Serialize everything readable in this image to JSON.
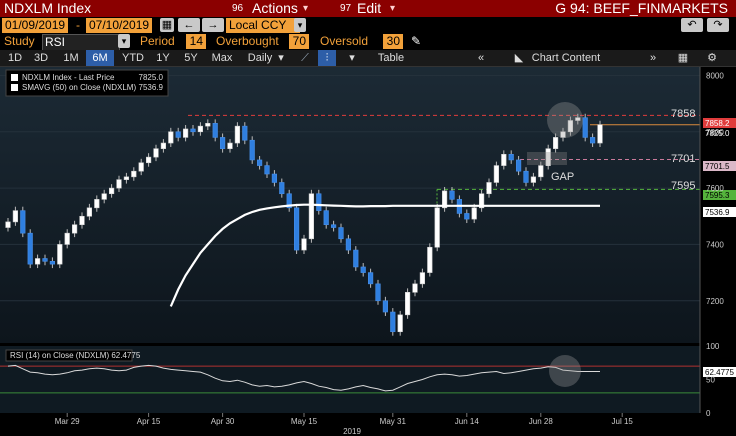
{
  "titlebar": {
    "ticker": "NDXLM Index",
    "actions_num": "96",
    "actions_label": "Actions",
    "edit_num": "97",
    "edit_label": "Edit",
    "page_label": "G 94: BEEF_FINMARKETS"
  },
  "controls": {
    "start_date": "01/09/2019",
    "end_date": "07/10/2019",
    "currency": "Local CCY",
    "study_label": "Study",
    "study_value": "RSI",
    "period_label": "Period",
    "period_value": "14",
    "overbought_label": "Overbought",
    "overbought_value": "70",
    "oversold_label": "Oversold",
    "oversold_value": "30"
  },
  "toolbar": {
    "ranges": [
      "1D",
      "3D",
      "1M",
      "6M",
      "YTD",
      "1Y",
      "5Y",
      "Max"
    ],
    "selected_range": "6M",
    "frequency": "Daily",
    "table_label": "Table",
    "chart_content_label": "Chart Content"
  },
  "legend": [
    {
      "name": "NDXLM Index - Last Price",
      "value": "7825.0"
    },
    {
      "name": "SMAVG (50)  on Close (NDXLM)",
      "value": "7536.9"
    }
  ],
  "annotations": {
    "level_high": "7858",
    "level_mid": "7701",
    "level_low": "7595",
    "gap_label": "GAP"
  },
  "badges": {
    "high": "7858.2",
    "last": "7825.0",
    "mid": "7701.5",
    "low": "7595.3",
    "sma": "7536.9",
    "rsi": "62.4775"
  },
  "rsi_legend": "RSI (14)  on Close (NDXLM)  62.4775",
  "year_label": "2019",
  "colors": {
    "up": "#ffffff",
    "down": "#2f7fe0",
    "sma": "#ffffff",
    "high_line": "#e03c3c",
    "low_line": "#55b43c"
  },
  "chart_data": {
    "type": "candlestick",
    "price_axis": {
      "min": 7050,
      "max": 8030,
      "ticks": [
        8000,
        7800,
        7600,
        7400,
        7200
      ]
    },
    "rsi_axis": {
      "min": 0,
      "max": 100,
      "ticks": [
        100,
        50,
        0
      ]
    },
    "x_tick_labels": [
      {
        "label": "Mar 29",
        "index": 8
      },
      {
        "label": "Apr 15",
        "index": 19
      },
      {
        "label": "Apr 30",
        "index": 29
      },
      {
        "label": "May 15",
        "index": 40
      },
      {
        "label": "May 31",
        "index": 52
      },
      {
        "label": "Jun 14",
        "index": 62
      },
      {
        "label": "Jun 28",
        "index": 72
      },
      {
        "label": "Jul 15",
        "index": 83
      }
    ],
    "levels": {
      "resistance": 7858.2,
      "last": 7825.0,
      "mid": 7701.5,
      "support": 7595.3,
      "sma": 7536.9
    },
    "closes": [
      7480,
      7520,
      7440,
      7330,
      7350,
      7340,
      7330,
      7400,
      7440,
      7470,
      7500,
      7530,
      7560,
      7580,
      7600,
      7630,
      7640,
      7660,
      7690,
      7710,
      7740,
      7760,
      7800,
      7780,
      7810,
      7800,
      7820,
      7830,
      7780,
      7740,
      7760,
      7820,
      7770,
      7700,
      7680,
      7650,
      7620,
      7580,
      7530,
      7380,
      7420,
      7580,
      7520,
      7470,
      7460,
      7420,
      7380,
      7320,
      7300,
      7260,
      7200,
      7160,
      7090,
      7150,
      7230,
      7260,
      7300,
      7390,
      7530,
      7590,
      7560,
      7510,
      7490,
      7530,
      7580,
      7620,
      7680,
      7720,
      7700,
      7660,
      7620,
      7640,
      7680,
      7740,
      7780,
      7800,
      7840,
      7850,
      7780,
      7760,
      7825
    ],
    "sma": [
      null,
      null,
      null,
      null,
      null,
      null,
      null,
      null,
      null,
      null,
      null,
      null,
      null,
      null,
      null,
      null,
      null,
      null,
      null,
      null,
      null,
      null,
      7180,
      7240,
      7290,
      7330,
      7370,
      7400,
      7430,
      7455,
      7475,
      7490,
      7505,
      7515,
      7523,
      7528,
      7532,
      7535,
      7538,
      7540,
      7541,
      7541,
      7540,
      7539,
      7538,
      7537,
      7536,
      7535,
      7535,
      7536,
      7536,
      7536,
      7537,
      7537,
      7537,
      7537,
      7537,
      7537,
      7537,
      7537,
      7537,
      7537
    ],
    "rsi": [
      70,
      71,
      66,
      61,
      60,
      58,
      57,
      58,
      60,
      63,
      64,
      66,
      67,
      66,
      64,
      63,
      64,
      68,
      70,
      71,
      70,
      67,
      65,
      64,
      63,
      62,
      61,
      57,
      52,
      48,
      47,
      49,
      46,
      42,
      40,
      41,
      39,
      40,
      42,
      45,
      47,
      44,
      40,
      38,
      35,
      34,
      36,
      39,
      41,
      38,
      36,
      33,
      34,
      39,
      44,
      47,
      50,
      54,
      57,
      58,
      57,
      55,
      56,
      58,
      60,
      61,
      62,
      59,
      60,
      62,
      64,
      66,
      67,
      69,
      68,
      64,
      63,
      62,
      62,
      62,
      62
    ]
  }
}
